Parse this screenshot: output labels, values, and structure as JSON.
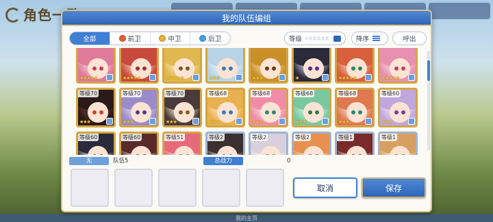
{
  "background": {
    "title": "角色一覧",
    "bottom_nav": [
      "我的主页",
      "",
      "",
      "",
      "",
      "",
      ""
    ]
  },
  "dialog": {
    "title": "我的队伍编组"
  },
  "filters": {
    "tabs": [
      {
        "label": "全部",
        "active": true,
        "icon": ""
      },
      {
        "label": "前卫",
        "active": false,
        "icon": "front-position-icon"
      },
      {
        "label": "中卫",
        "active": false,
        "icon": "middle-position-icon"
      },
      {
        "label": "后卫",
        "active": false,
        "icon": "back-position-icon"
      }
    ],
    "sort_label": "等级",
    "order_label": "降序",
    "call_label": "呼出"
  },
  "roster": [
    {
      "level": "",
      "stars": 5,
      "c1": "#f7c9d6",
      "c2": "#e07a9a",
      "eye": "#c2405a"
    },
    {
      "level": "",
      "stars": 5,
      "c1": "#f5c4b5",
      "c2": "#c84a3c",
      "eye": "#a03030"
    },
    {
      "level": "",
      "stars": 5,
      "c1": "#f8e6b0",
      "c2": "#e0b850",
      "eye": "#7a5a20"
    },
    {
      "level": "",
      "stars": 3,
      "c1": "#e8f2f8",
      "c2": "#b8d4e6",
      "eye": "#3a7ab8"
    },
    {
      "level": "",
      "stars": 3,
      "c1": "#f5d08a",
      "c2": "#c9902a",
      "eye": "#6a3a10"
    },
    {
      "level": "",
      "stars": 1,
      "c1": "#c8c0d8",
      "c2": "#2a2a3a",
      "eye": "#5a2a8a"
    },
    {
      "level": "",
      "stars": 5,
      "c1": "#f6c0b0",
      "c2": "#d8603c",
      "eye": "#2a8a5a"
    },
    {
      "level": "",
      "stars": 5,
      "c1": "#f6d0dc",
      "c2": "#e890b0",
      "eye": "#c04060"
    },
    {
      "level": "等级70",
      "stars": 3,
      "c1": "#6a3a2a",
      "c2": "#2a1a18",
      "eye": "#d04020"
    },
    {
      "level": "等级70",
      "stars": 3,
      "c1": "#d8d4ec",
      "c2": "#9a8cc8",
      "eye": "#4a3a8a"
    },
    {
      "level": "等级70",
      "stars": 3,
      "c1": "#e8e0c0",
      "c2": "#4a3a3a",
      "eye": "#8a5a20"
    },
    {
      "level": "等级68",
      "stars": 3,
      "c1": "#fbe3b0",
      "c2": "#e8b050",
      "eye": "#3a7ab8"
    },
    {
      "level": "等级68",
      "stars": 3,
      "c1": "#fbd4dc",
      "c2": "#f08ca8",
      "eye": "#2a8a7a"
    },
    {
      "level": "等级68",
      "stars": 3,
      "c1": "#d4f0dc",
      "c2": "#7ac8a0",
      "eye": "#2a7a4a"
    },
    {
      "level": "等级68",
      "stars": 3,
      "c1": "#f8d0c0",
      "c2": "#e07850",
      "eye": "#2a8a6a"
    },
    {
      "level": "等级60",
      "stars": 3,
      "c1": "#ece0f4",
      "c2": "#c0a8dc",
      "eye": "#7a3a9a"
    },
    {
      "level": "等级60",
      "stars": 0,
      "c1": "#d8d8e8",
      "c2": "#2a2a3a",
      "eye": "#6a5a2a"
    },
    {
      "level": "等级60",
      "stars": 0,
      "c1": "#e8d0c8",
      "c2": "#5a2a2a",
      "eye": "#8a2a3a"
    },
    {
      "level": "等级51",
      "stars": 0,
      "c1": "#f8d0d4",
      "c2": "#e86a7a",
      "eye": "#4a8ab8"
    },
    {
      "level": "等级2",
      "stars": 0,
      "c1": "#e8e0d0",
      "c2": "#3a3030",
      "eye": "#3a8a5a"
    },
    {
      "level": "等级2",
      "stars": 0,
      "c1": "#f4f0f4",
      "c2": "#d8d0dc",
      "eye": "#3a9a6a"
    },
    {
      "level": "等级2",
      "stars": 0,
      "c1": "#f8dcc0",
      "c2": "#e89050",
      "eye": "#3a6ab8"
    },
    {
      "level": "等级1",
      "stars": 0,
      "c1": "#e8d0c8",
      "c2": "#7a2a2a",
      "eye": "#8a2a3a"
    },
    {
      "level": "等级1",
      "stars": 0,
      "c1": "#f8e4c4",
      "c2": "#d8a060",
      "eye": "#5a8a3a"
    }
  ],
  "party": {
    "slot_label": "无",
    "name": "队伍5",
    "power_label": "总战力",
    "power_value": "0"
  },
  "buttons": {
    "cancel": "取消",
    "save": "保存"
  }
}
